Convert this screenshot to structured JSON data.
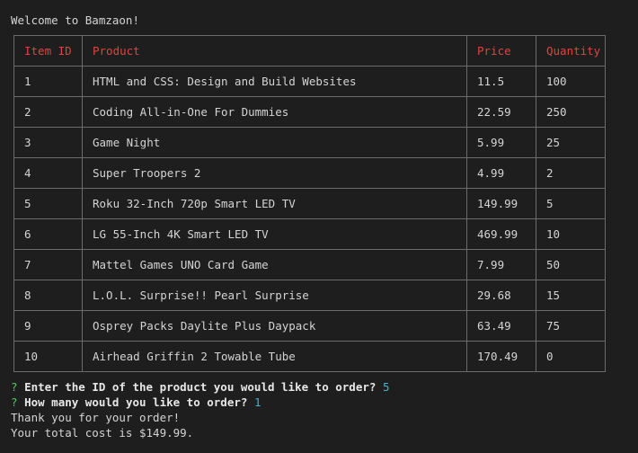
{
  "terminal": {
    "welcome": "Welcome to Bamzaon!",
    "table": {
      "headers": [
        "Item ID",
        "Product",
        "Price",
        "Quantity"
      ],
      "rows": [
        [
          "1",
          "HTML and CSS: Design and Build Websites",
          "11.5",
          "100"
        ],
        [
          "2",
          "Coding All-in-One For Dummies",
          "22.59",
          "250"
        ],
        [
          "3",
          "Game Night",
          "5.99",
          "25"
        ],
        [
          "4",
          "Super Troopers 2",
          "4.99",
          "2"
        ],
        [
          "5",
          "Roku 32-Inch 720p Smart LED TV",
          "149.99",
          "5"
        ],
        [
          "6",
          "LG 55-Inch 4K Smart LED TV",
          "469.99",
          "10"
        ],
        [
          "7",
          "Mattel Games UNO Card Game",
          "7.99",
          "50"
        ],
        [
          "8",
          "L.O.L. Surprise!! Pearl Surprise",
          "29.68",
          "15"
        ],
        [
          "9",
          "Osprey Packs Daylite Plus Daypack",
          "63.49",
          "75"
        ],
        [
          "10",
          "Airhead Griffin 2 Towable Tube",
          "170.49",
          "0"
        ]
      ]
    },
    "prompts": [
      {
        "marker": "?",
        "question": "Enter the ID of the product you would like to order?",
        "answer": "5"
      },
      {
        "marker": "?",
        "question": "How many would you like to order?",
        "answer": "1"
      }
    ],
    "thanks": "Thank you for your order!",
    "total": "Your total cost is $149.99."
  },
  "colors": {
    "background": "#1e1e1e",
    "text": "#d4d4d4",
    "header": "#e04343",
    "prompt_marker": "#4ec963",
    "answer": "#3fb5d0",
    "border": "#6b6b6b"
  }
}
